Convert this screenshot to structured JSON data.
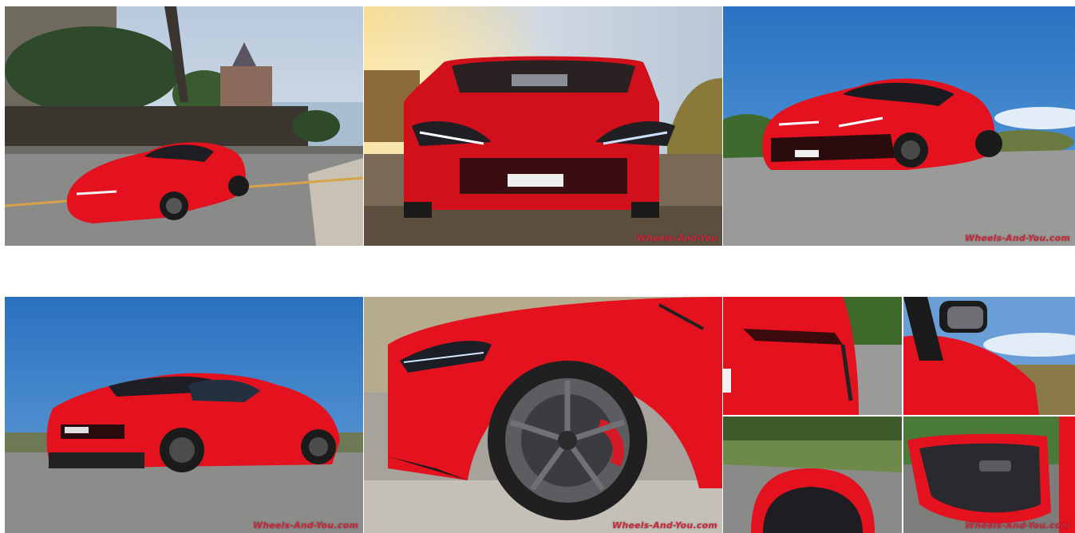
{
  "gallery": {
    "items": [
      {
        "subject": "red coupe on seaside street",
        "watermark": ""
      },
      {
        "subject": "red coupe front view at sunset",
        "watermark": "Wheels-And-You"
      },
      {
        "subject": "red coupe three-quarter front view",
        "watermark": "Wheels-And-You.com"
      },
      {
        "subject": "red coupe rear three-quarter view",
        "watermark": "Wheels-And-You.com"
      },
      {
        "subject": "front wheel and brake caliper close-up",
        "watermark": "Wheels-And-You.com"
      },
      {
        "subject": "detail collage: tail light, mirror, trunk, door interior",
        "watermark": "Wheels-And-You.com"
      }
    ]
  },
  "colors": {
    "car_red": "#e3121e",
    "sky_blue": "#2f7fc8",
    "road_gray": "#8e8e8e",
    "watermark": "#c8283a"
  }
}
